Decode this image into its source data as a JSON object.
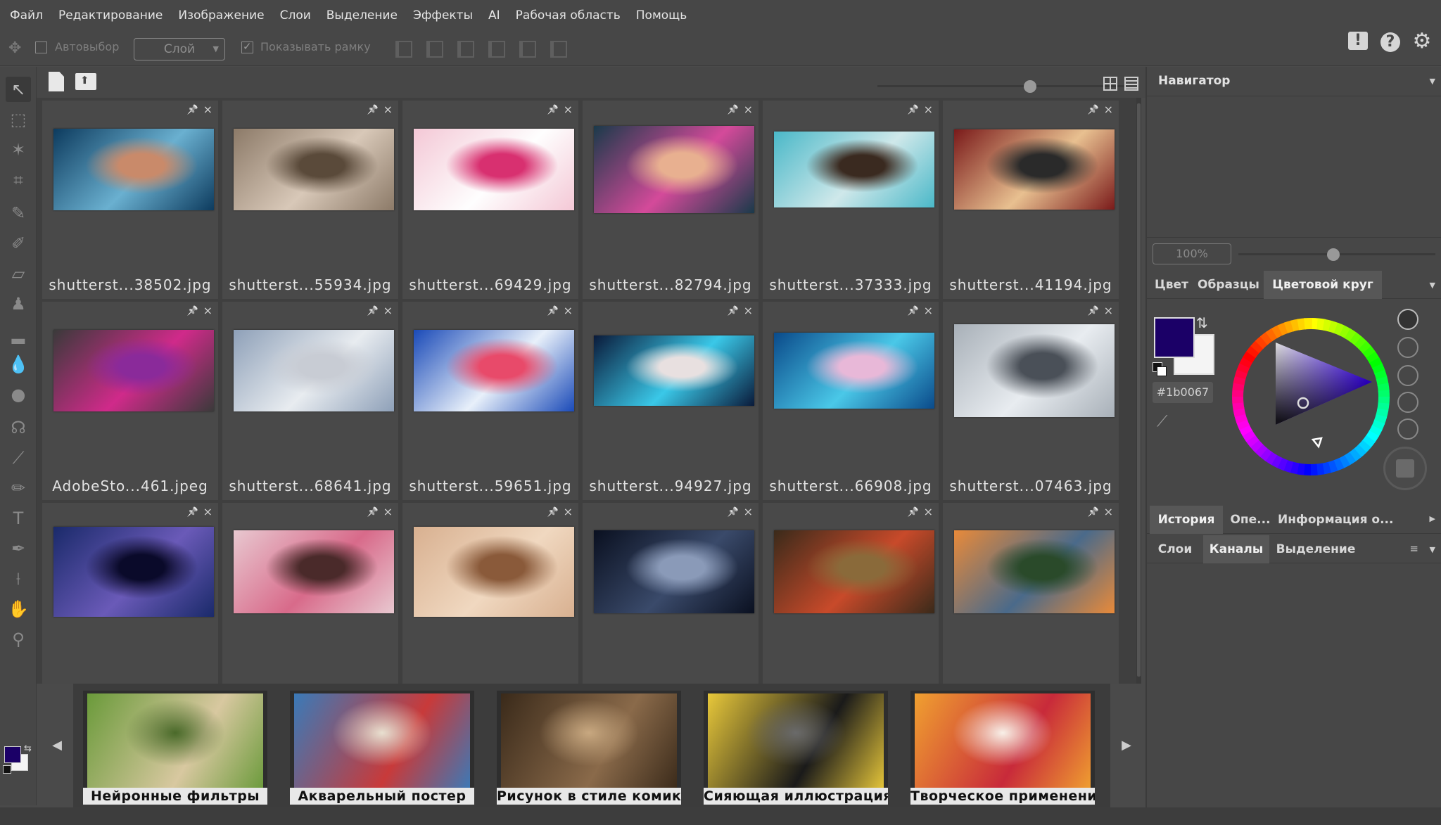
{
  "menu": [
    "Файл",
    "Редактирование",
    "Изображение",
    "Слои",
    "Выделение",
    "Эффекты",
    "AI",
    "Рабочая область",
    "Помощь"
  ],
  "options": {
    "autoselect_label": "Автовыбор",
    "layer_select_value": "Слой",
    "show_frame_label": "Показывать рамку"
  },
  "top_icons": [
    "alert-icon",
    "help-icon",
    "settings-icon"
  ],
  "thumbnails": [
    {
      "name": "shutterst...38502.jpg",
      "colors": [
        "#0d3b5e",
        "#6ab0d0",
        "#c98a6a"
      ]
    },
    {
      "name": "shutterst...55934.jpg",
      "colors": [
        "#8c7a68",
        "#d8c8b8",
        "#5a4a3a"
      ]
    },
    {
      "name": "shutterst...69429.jpg",
      "colors": [
        "#f4c8d6",
        "#fefefe",
        "#d83070"
      ]
    },
    {
      "name": "shutterst...82794.jpg",
      "colors": [
        "#1a3a4a",
        "#d44a9a",
        "#e8b090"
      ]
    },
    {
      "name": "shutterst...37333.jpg",
      "colors": [
        "#4ab8c8",
        "#cfe8ea",
        "#3a2a20"
      ]
    },
    {
      "name": "shutterst...41194.jpg",
      "colors": [
        "#7a1a1a",
        "#e8c090",
        "#2a2a2a"
      ]
    },
    {
      "name": "AdobeSto...461.jpeg",
      "colors": [
        "#3a3a3a",
        "#d02a8a",
        "#8a2a9a"
      ]
    },
    {
      "name": "shutterst...68641.jpg",
      "colors": [
        "#8ea0b8",
        "#e8ecf0",
        "#c8ccd4"
      ]
    },
    {
      "name": "shutterst...59651.jpg",
      "colors": [
        "#1a4ab8",
        "#e8f0fa",
        "#e84a6a"
      ]
    },
    {
      "name": "shutterst...94927.jpg",
      "colors": [
        "#0a1a3a",
        "#3ac8e8",
        "#e8e0e0"
      ]
    },
    {
      "name": "shutterst...66908.jpg",
      "colors": [
        "#0a4a8a",
        "#4ac8e8",
        "#e8b8d8"
      ]
    },
    {
      "name": "shutterst...07463.jpg",
      "colors": [
        "#a8b0b8",
        "#e8ecf0",
        "#4a5058"
      ]
    },
    {
      "name": "",
      "colors": [
        "#1a2a6a",
        "#6a5ab8",
        "#0a0a2a"
      ]
    },
    {
      "name": "",
      "colors": [
        "#e8c8d0",
        "#d86a8a",
        "#4a2a2a"
      ]
    },
    {
      "name": "",
      "colors": [
        "#d8b090",
        "#f0d8c0",
        "#8a5a3a"
      ]
    },
    {
      "name": "",
      "colors": [
        "#0a1020",
        "#3a4a6a",
        "#8a9ab8"
      ]
    },
    {
      "name": "",
      "colors": [
        "#3a2a1a",
        "#c84a2a",
        "#8a6a3a"
      ]
    },
    {
      "name": "",
      "colors": [
        "#e88a3a",
        "#4a6a8a",
        "#2a4a2a"
      ]
    }
  ],
  "filmstrip": [
    {
      "label": "Нейронные фильтры",
      "colors": [
        "#6a9a3a",
        "#d8c8a0",
        "#4a6a2a"
      ]
    },
    {
      "label": "Акварельный постер",
      "colors": [
        "#3a7ab8",
        "#c83a3a",
        "#e8e0d0"
      ]
    },
    {
      "label": "Рисунок в стиле комикс",
      "colors": [
        "#3a2a1a",
        "#8a6a4a",
        "#c8a880"
      ]
    },
    {
      "label": "Сияющая иллюстрация",
      "colors": [
        "#e8c83a",
        "#1a1a1a",
        "#6a6a6a"
      ]
    },
    {
      "label": "Творческое применение...",
      "colors": [
        "#f0a030",
        "#c82a3a",
        "#f8f0e8"
      ]
    }
  ],
  "navigator": {
    "title": "Навигатор",
    "zoom": "100%"
  },
  "color_tabs": [
    "Цвет",
    "Образцы",
    "Цветовой круг"
  ],
  "color_tab_active": "Цветовой круг",
  "color": {
    "foreground": "#1b0067",
    "background": "#f4f4f4",
    "hex_label": "#1b0067"
  },
  "history_tabs": [
    "История",
    "Опе...",
    "Информация о..."
  ],
  "history_tab_active": "История",
  "layers_tabs": [
    "Слои",
    "Каналы",
    "Выделение"
  ],
  "layers_tab_active": "Каналы"
}
